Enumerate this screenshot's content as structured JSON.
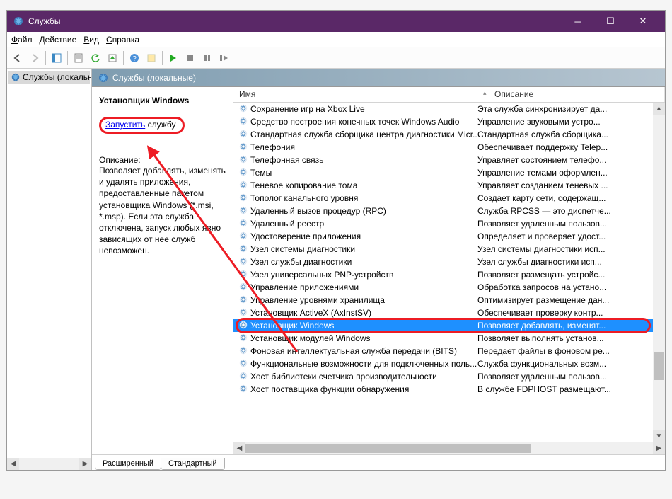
{
  "window": {
    "title": "Службы"
  },
  "menu": {
    "file": "Файл",
    "action": "Действие",
    "view": "Вид",
    "help": "Справка"
  },
  "tree": {
    "root": "Службы (локальные)"
  },
  "right_header": {
    "title": "Службы (локальные)"
  },
  "detail": {
    "service_name": "Установщик Windows",
    "link_start": "Запустить",
    "link_rest": " службу",
    "desc_label": "Описание:",
    "desc_text": "Позволяет добавлять, изменять и удалять приложения, предоставленные пакетом установщика Windows (*.msi, *.msp). Если эта служба отключена, запуск любых явно зависящих от нее служб невозможен."
  },
  "columns": {
    "name": "Имя",
    "desc": "Описание"
  },
  "services": [
    {
      "name": "Сохранение игр на Xbox Live",
      "desc": "Эта служба синхронизирует да..."
    },
    {
      "name": "Средство построения конечных точек Windows Audio",
      "desc": "Управление звуковыми устро..."
    },
    {
      "name": "Стандартная служба сборщика центра диагностики Micr...",
      "desc": "Стандартная служба сборщика..."
    },
    {
      "name": "Телефония",
      "desc": "Обеспечивает поддержку Telep..."
    },
    {
      "name": "Телефонная связь",
      "desc": "Управляет состоянием телефо..."
    },
    {
      "name": "Темы",
      "desc": "Управление темами оформлен..."
    },
    {
      "name": "Теневое копирование тома",
      "desc": "Управляет созданием теневых ..."
    },
    {
      "name": "Тополог канального уровня",
      "desc": "Создает карту сети, содержащ..."
    },
    {
      "name": "Удаленный вызов процедур (RPC)",
      "desc": "Служба RPCSS — это диспетче..."
    },
    {
      "name": "Удаленный реестр",
      "desc": "Позволяет удаленным пользов..."
    },
    {
      "name": "Удостоверение приложения",
      "desc": "Определяет и проверяет удост..."
    },
    {
      "name": "Узел системы диагностики",
      "desc": "Узел системы диагностики исп..."
    },
    {
      "name": "Узел службы диагностики",
      "desc": "Узел службы диагностики исп..."
    },
    {
      "name": "Узел универсальных PNP-устройств",
      "desc": "Позволяет размещать устройс..."
    },
    {
      "name": "Управление приложениями",
      "desc": "Обработка запросов на устано..."
    },
    {
      "name": "Управление уровнями хранилища",
      "desc": "Оптимизирует размещение дан..."
    },
    {
      "name": "Установщик ActiveX (AxInstSV)",
      "desc": "Обеспечивает проверку контр..."
    },
    {
      "name": "Установщик Windows",
      "desc": "Позволяет добавлять, изменят...",
      "selected": true
    },
    {
      "name": "Установщик модулей Windows",
      "desc": "Позволяет выполнять установ..."
    },
    {
      "name": "Фоновая интеллектуальная служба передачи (BITS)",
      "desc": "Передает файлы в фоновом ре..."
    },
    {
      "name": "Функциональные возможности для подключенных поль...",
      "desc": "Служба функциональных возм..."
    },
    {
      "name": "Хост библиотеки счетчика производительности",
      "desc": "Позволяет удаленным пользов..."
    },
    {
      "name": "Хост поставщика функции обнаружения",
      "desc": "В службе FDPHOST размещают..."
    }
  ],
  "tabs": {
    "extended": "Расширенный",
    "standard": "Стандартный"
  }
}
